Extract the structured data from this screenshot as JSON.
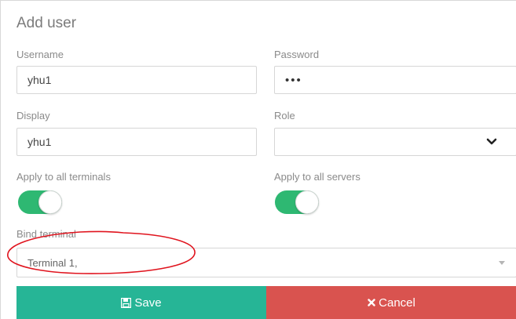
{
  "form": {
    "title": "Add user",
    "username": {
      "label": "Username",
      "value": "yhu1"
    },
    "password": {
      "label": "Password",
      "value": "•••"
    },
    "display": {
      "label": "Display",
      "value": "yhu1"
    },
    "role": {
      "label": "Role",
      "value": ""
    },
    "apply_terminals": {
      "label": "Apply to all terminals",
      "on": true
    },
    "apply_servers": {
      "label": "Apply to all servers",
      "on": true
    },
    "bind_terminal": {
      "label": "Bind terminal",
      "value": "Terminal 1,"
    }
  },
  "buttons": {
    "save_label": "Save",
    "cancel_label": "Cancel"
  },
  "colors": {
    "toggle_on": "#2eb872",
    "save": "#26b596",
    "cancel": "#d9534f",
    "annotation": "#e0141e"
  },
  "icons": {
    "save": "floppy-disk-icon",
    "cancel": "close-icon",
    "role_dropdown": "chevron-down-icon",
    "bind_dropdown": "caret-down-icon"
  }
}
